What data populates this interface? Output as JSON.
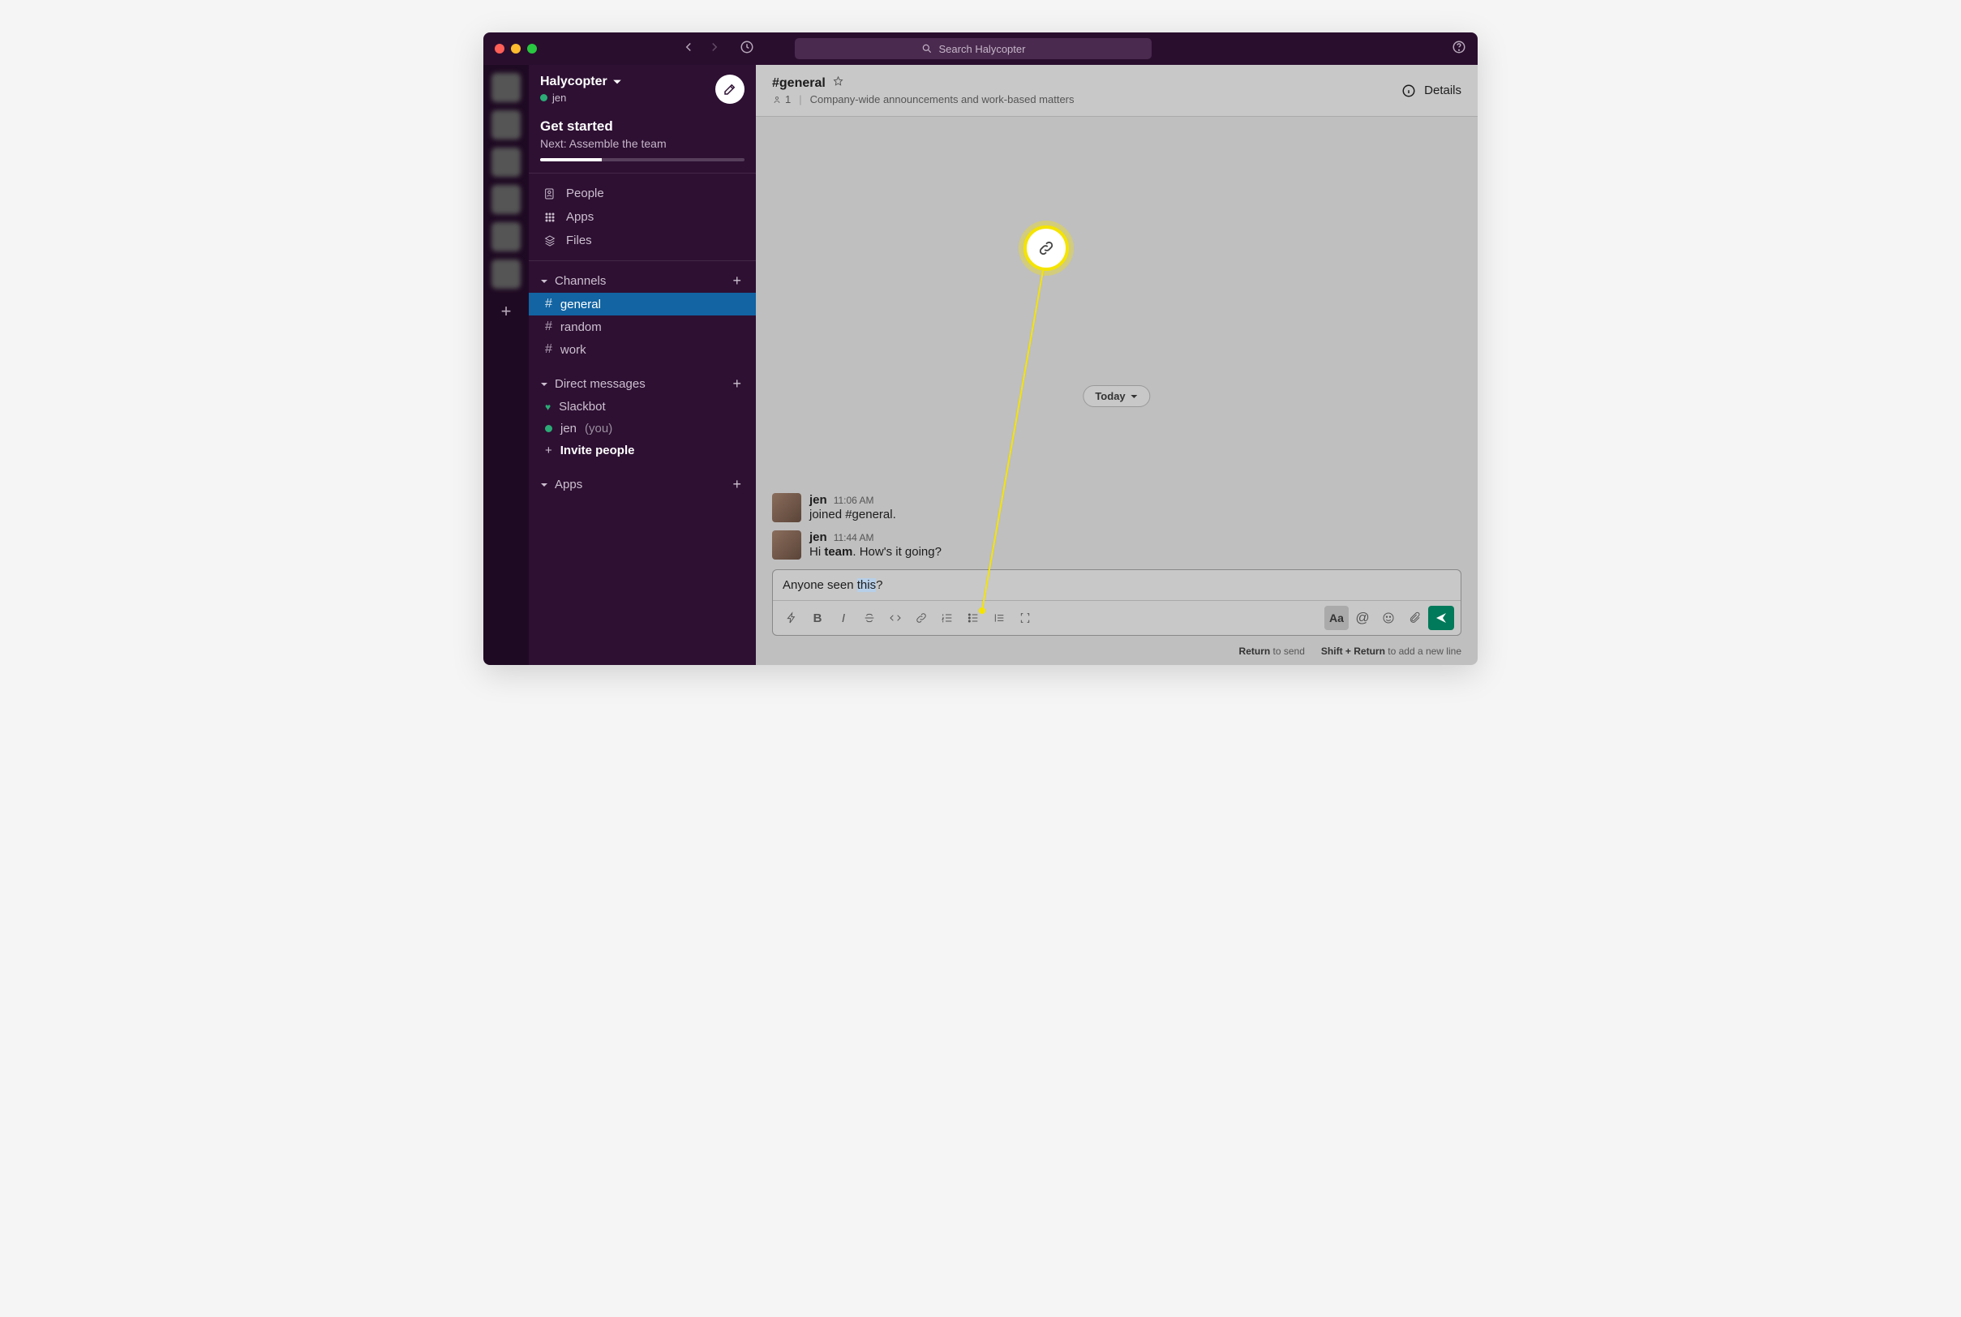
{
  "titlebar": {
    "search_placeholder": "Search Halycopter"
  },
  "workspace": {
    "name": "Halycopter",
    "user": "jen"
  },
  "get_started": {
    "title": "Get started",
    "next": "Next: Assemble the team"
  },
  "browse": {
    "people": "People",
    "apps": "Apps",
    "files": "Files"
  },
  "sections": {
    "channels_label": "Channels",
    "dm_label": "Direct messages",
    "apps_label": "Apps"
  },
  "channels": [
    {
      "name": "general",
      "active": true
    },
    {
      "name": "random",
      "active": false
    },
    {
      "name": "work",
      "active": false
    }
  ],
  "dms": {
    "slackbot": "Slackbot",
    "self": "jen",
    "you_label": "(you)",
    "invite": "Invite people"
  },
  "channel_header": {
    "name": "#general",
    "members": "1",
    "topic": "Company-wide announcements and work-based matters",
    "details": "Details"
  },
  "divider": {
    "today": "Today"
  },
  "messages": [
    {
      "author": "jen",
      "time": "11:06 AM",
      "text_plain": "joined #general."
    },
    {
      "author": "jen",
      "time": "11:44 AM",
      "text_prefix": "Hi ",
      "text_bold": "team",
      "text_suffix": ". How's it going?"
    }
  ],
  "composer": {
    "text_prefix": "Anyone seen ",
    "text_selected": "this",
    "text_suffix": "?"
  },
  "hints": {
    "return_b": "Return",
    "return_t": " to send",
    "shift_b": "Shift + Return",
    "shift_t": " to add a new line"
  }
}
